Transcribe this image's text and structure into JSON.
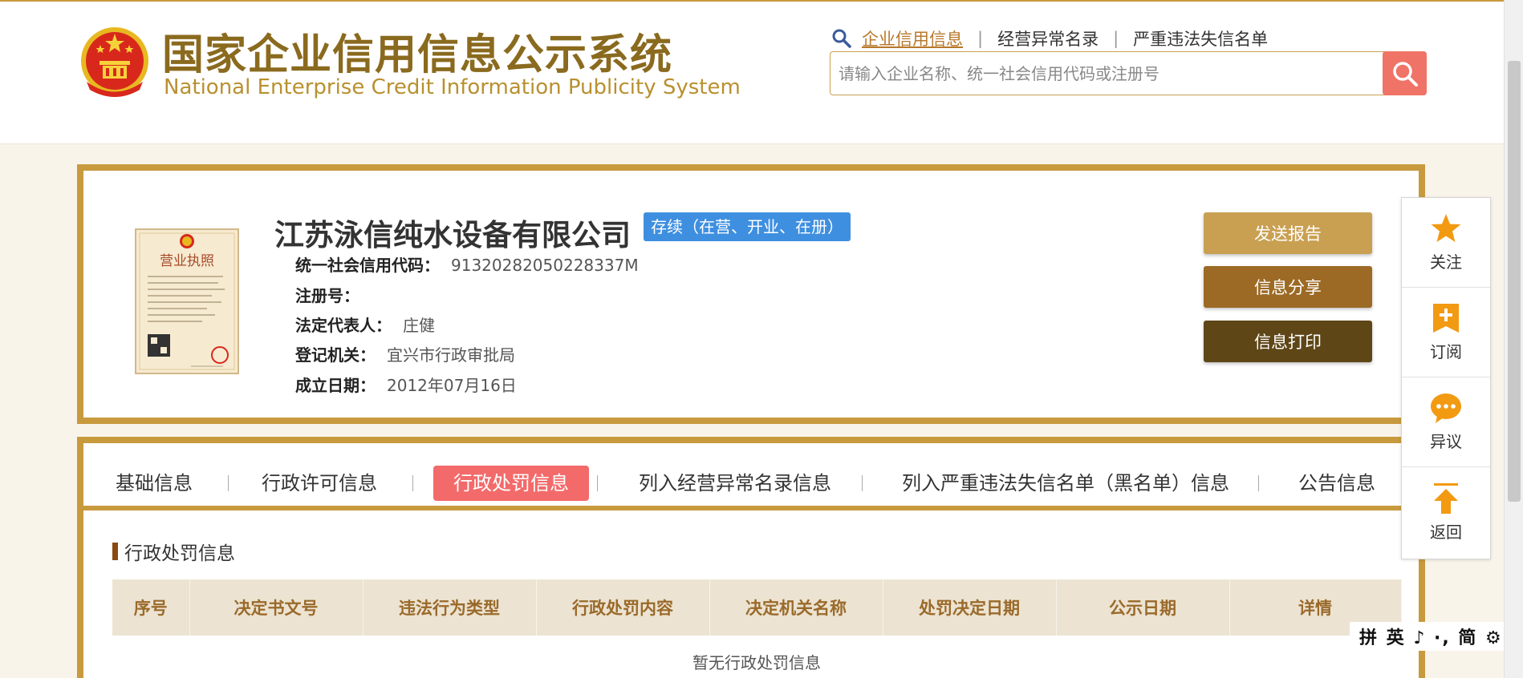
{
  "header": {
    "title_cn": "国家企业信用信息公示系统",
    "title_en": "National Enterprise Credit Information Publicity System",
    "links": [
      "企业信用信息",
      "经营异常名录",
      "严重违法失信名单"
    ],
    "search_placeholder": "请输入企业名称、统一社会信用代码或注册号"
  },
  "company": {
    "name": "江苏泳信纯水设备有限公司",
    "status": "存续（在营、开业、在册）",
    "license_label": "营业执照",
    "fields": [
      {
        "label": "统一社会信用代码：",
        "value": "91320282050228337M"
      },
      {
        "label": "注册号：",
        "value": ""
      },
      {
        "label": "法定代表人：",
        "value": "庄健"
      },
      {
        "label": "登记机关：",
        "value": "宜兴市行政审批局"
      },
      {
        "label": "成立日期：",
        "value": "2012年07月16日"
      }
    ],
    "actions": [
      "发送报告",
      "信息分享",
      "信息打印"
    ]
  },
  "tabs": [
    "基础信息",
    "行政许可信息",
    "行政处罚信息",
    "列入经营异常名录信息",
    "列入严重违法失信名单（黑名单）信息",
    "公告信息"
  ],
  "active_tab": "行政处罚信息",
  "section": {
    "title": "行政处罚信息",
    "columns": [
      "序号",
      "决定书文号",
      "违法行为类型",
      "行政处罚内容",
      "决定机关名称",
      "处罚决定日期",
      "公示日期",
      "详情"
    ],
    "empty_text": "暂无行政处罚信息"
  },
  "side_panel": [
    {
      "label": "关注",
      "icon": "star-icon"
    },
    {
      "label": "订阅",
      "icon": "bookmark-plus-icon"
    },
    {
      "label": "异议",
      "icon": "chat-bubble-icon"
    },
    {
      "label": "返回",
      "icon": "back-to-top-icon"
    }
  ],
  "ime_toolbar": "拼 英 ♪ ·, 简 ⚙ ㄅ",
  "colors": {
    "accent_gold": "#c89a3e",
    "status_blue": "#3f8fe0",
    "active_tab_red": "#f36a6a",
    "btn_send": "#c9a052",
    "btn_share": "#9c6a25",
    "btn_print": "#5e4617",
    "side_icon_orange": "#f29a12"
  }
}
